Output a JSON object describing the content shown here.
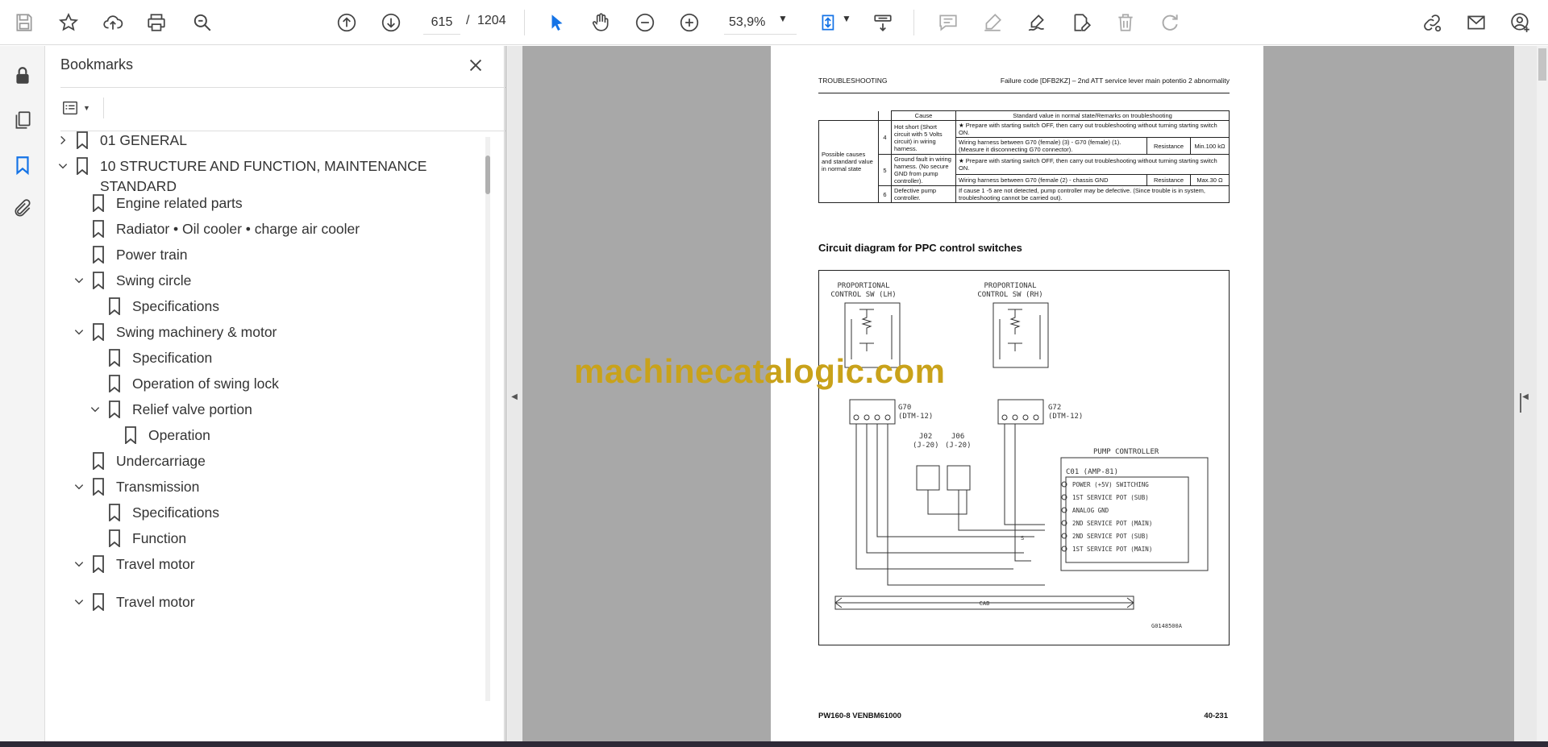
{
  "toolbar": {
    "page_current": "615",
    "page_separator": "/",
    "page_total": "1204",
    "zoom": "53,9%"
  },
  "panel": {
    "title": "Bookmarks"
  },
  "bookmarks": [
    {
      "label": "01 GENERAL",
      "chevron": "right"
    },
    {
      "label": "10 STRUCTURE AND FUNCTION, MAINTENANCE",
      "label2": "STANDARD",
      "chevron": "down"
    },
    {
      "label": "Engine related parts",
      "chevron": ""
    },
    {
      "label": "Radiator • Oil cooler • charge air cooler",
      "chevron": ""
    },
    {
      "label": "Power train",
      "chevron": ""
    },
    {
      "label": "Swing circle",
      "chevron": "down"
    },
    {
      "label": "Specifications",
      "chevron": ""
    },
    {
      "label": "Swing machinery & motor",
      "chevron": "down"
    },
    {
      "label": "Specification",
      "chevron": ""
    },
    {
      "label": "Operation of swing lock",
      "chevron": ""
    },
    {
      "label": "Relief valve portion",
      "chevron": "down"
    },
    {
      "label": "Operation",
      "chevron": ""
    },
    {
      "label": "Undercarriage",
      "chevron": ""
    },
    {
      "label": "Transmission",
      "chevron": "down"
    },
    {
      "label": "Specifications",
      "chevron": ""
    },
    {
      "label": "Function",
      "chevron": ""
    },
    {
      "label": "Travel motor",
      "chevron": "down"
    },
    {
      "label": "Travel motor",
      "chevron": "down"
    }
  ],
  "document": {
    "header_left": "TROUBLESHOOTING",
    "header_right": "Failure code [DFB2KZ] – 2nd ATT service lever main potentio 2 abnormality",
    "table": {
      "col_cause": "Cause",
      "col_standard": "Standard value in normal state/Remarks on troubleshooting",
      "row_header": "Possible causes and standard value in normal state",
      "rows": [
        {
          "no": "4",
          "cause": "Hot short (Short circuit with 5 Volts circuit) in wiring harness.",
          "note": "★   Prepare with starting switch OFF, then carry out troubleshooting without turning starting switch ON.",
          "check": "Wiring harness between G70 (female) (3) - G70 (female) (1). (Measure it disconnecting G70 connector).",
          "item": "Resistance",
          "value": "Min.100 kΩ"
        },
        {
          "no": "5",
          "cause": "Ground fault in wiring harness. (No secure GND from pump controller).",
          "note": "★   Prepare with starting switch OFF, then carry out troubleshooting without turning starting switch ON.",
          "check": "Wiring harness between G70 (female (2) - chassis GND",
          "item": "Resistance",
          "value": "Max.30 Ω"
        },
        {
          "no": "6",
          "cause": "Defective pump controller.",
          "note": "If cause 1 -5 are not detected, pump controller may be defective. (Since trouble is in system, troubleshooting cannot be carried out)."
        }
      ]
    },
    "circuit_title": "Circuit diagram for PPC control switches",
    "circuit": {
      "sw_lh_1": "PROPORTIONAL",
      "sw_lh_2": "CONTROL SW (LH)",
      "sw_rh_1": "PROPORTIONAL",
      "sw_rh_2": "CONTROL SW (RH)",
      "g70_1": "G70",
      "g70_2": "(DTM-12)",
      "g72_1": "G72",
      "g72_2": "(DTM-12)",
      "j02_1": "J02",
      "j02_2": "(J-20)",
      "j06_1": "J06",
      "j06_2": "(J-20)",
      "controller": "PUMP CONTROLLER",
      "connector": "C01 (AMP-81)",
      "pins": [
        "POWER (+5V) SWITCHING",
        "1ST SERVICE POT (SUB)",
        "ANALOG GND",
        "2ND SERVICE POT (MAIN)",
        "2ND SERVICE POT (SUB)",
        "1ST SERVICE POT (MAIN)"
      ],
      "cab": "CAB",
      "ref": "G0148500A",
      "s_mark": "S"
    },
    "watermark": "machinecatalogic.com",
    "footer_left": "PW160-8    VENBM61000",
    "footer_right": "40-231"
  },
  "colors": {
    "accent_blue": "#1473e6",
    "watermark": "#c9a21a",
    "doc_bg": "#a8a8a8"
  }
}
